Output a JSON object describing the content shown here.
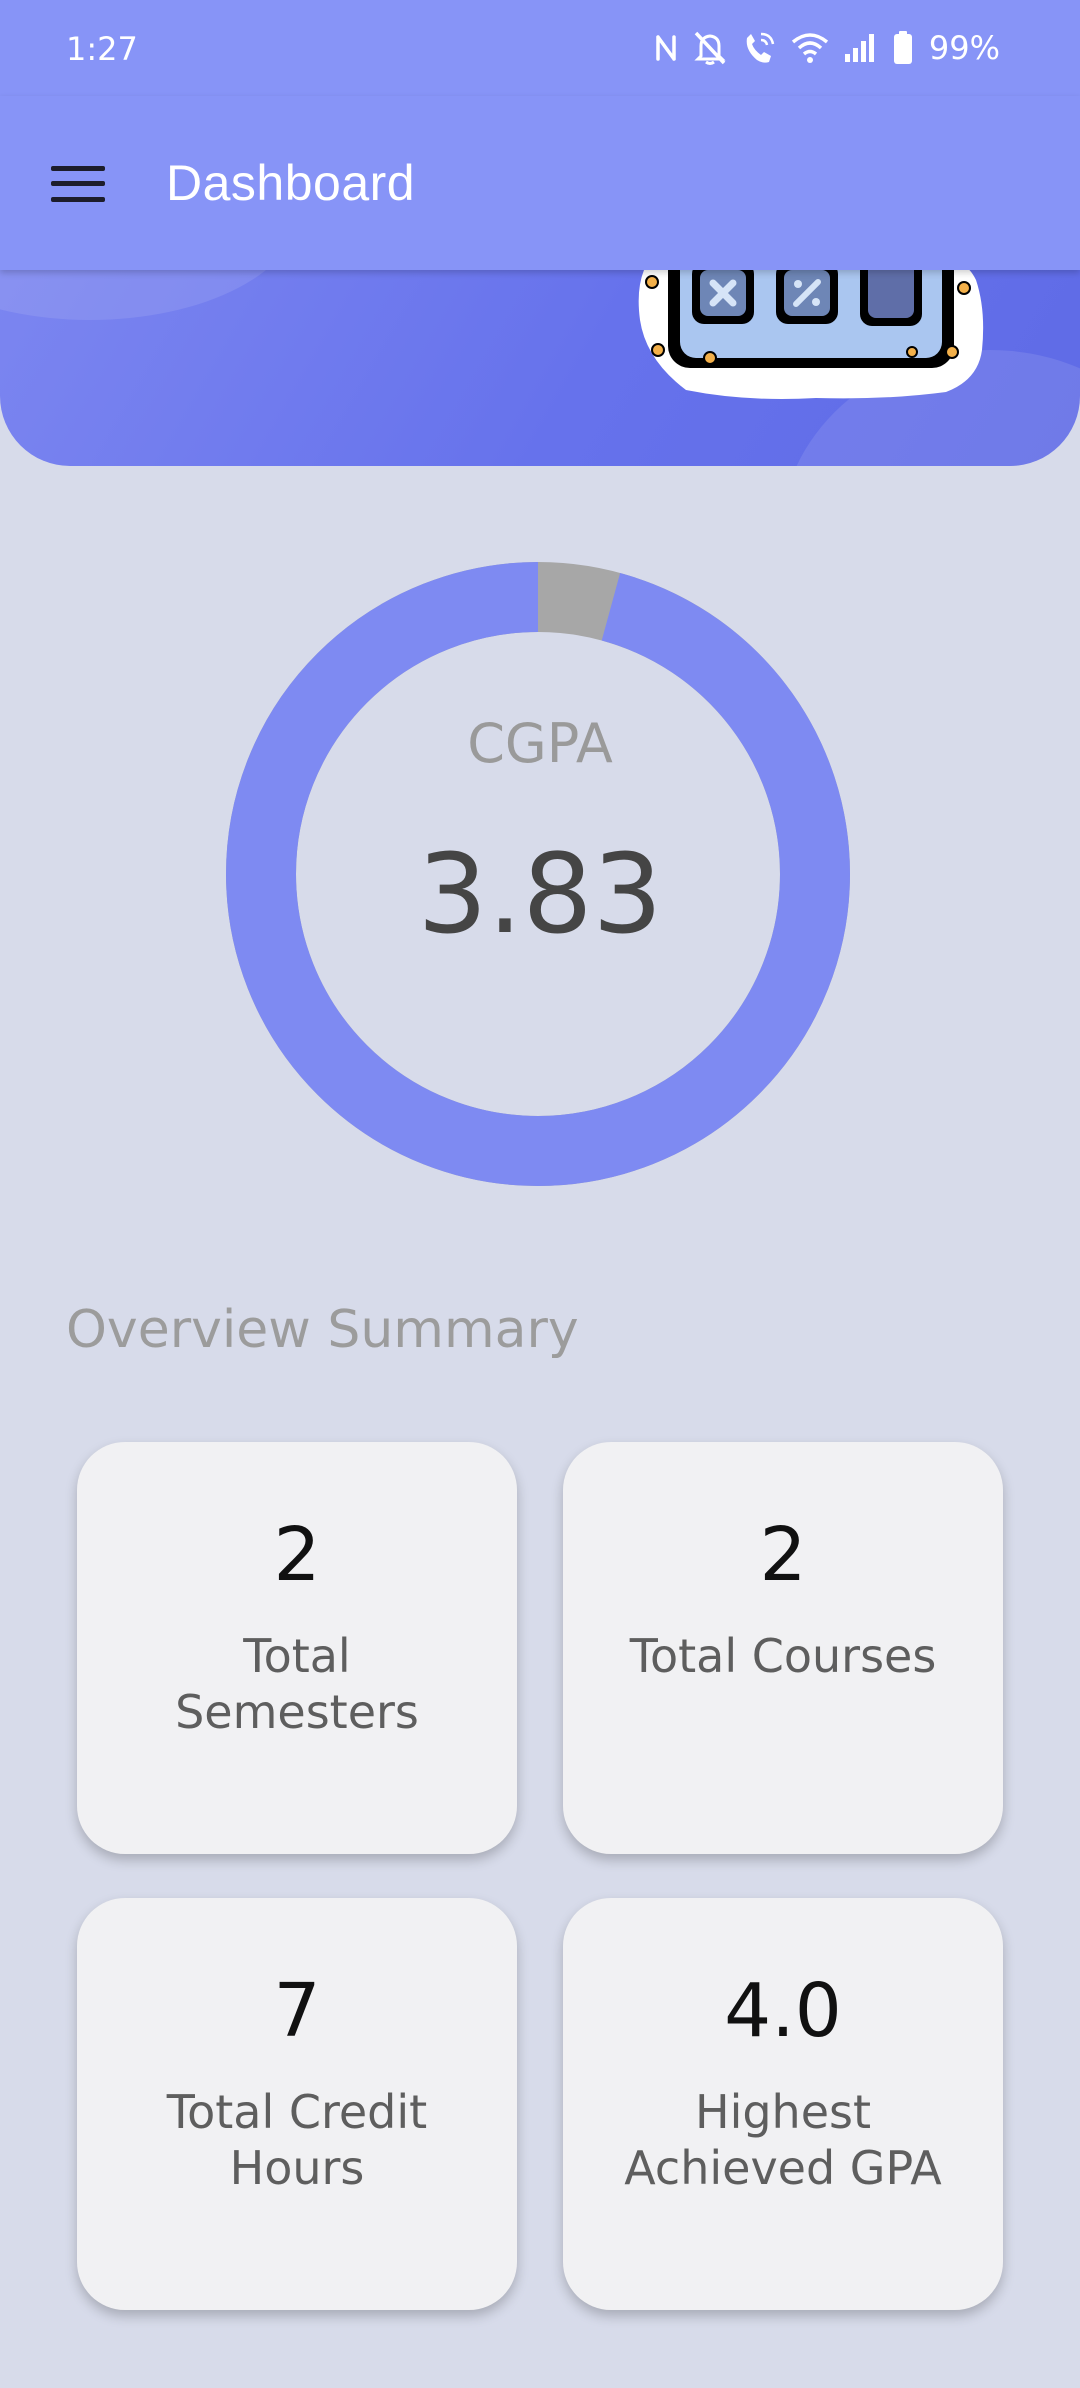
{
  "status_bar": {
    "time": "1:27",
    "battery": "99%",
    "icons": [
      "nfc-icon",
      "mute-icon",
      "wifi-call-icon",
      "wifi-icon",
      "signal-icon",
      "battery-icon"
    ]
  },
  "app_bar": {
    "title": "Dashboard",
    "menu_icon": "menu-icon",
    "color": "#8794f7"
  },
  "cgpa": {
    "label": "CGPA",
    "value": "3.83",
    "max": 4.0,
    "ring_color": "#7e8af2",
    "remainder_color": "#a7a7a7"
  },
  "overview": {
    "title": "Overview Summary",
    "cards": [
      {
        "value": "2",
        "label": "Total Semesters"
      },
      {
        "value": "2",
        "label": "Total Courses"
      },
      {
        "value": "7",
        "label": "Total Credit Hours"
      },
      {
        "value": "4.0",
        "label": "Highest Achieved GPA"
      }
    ]
  }
}
